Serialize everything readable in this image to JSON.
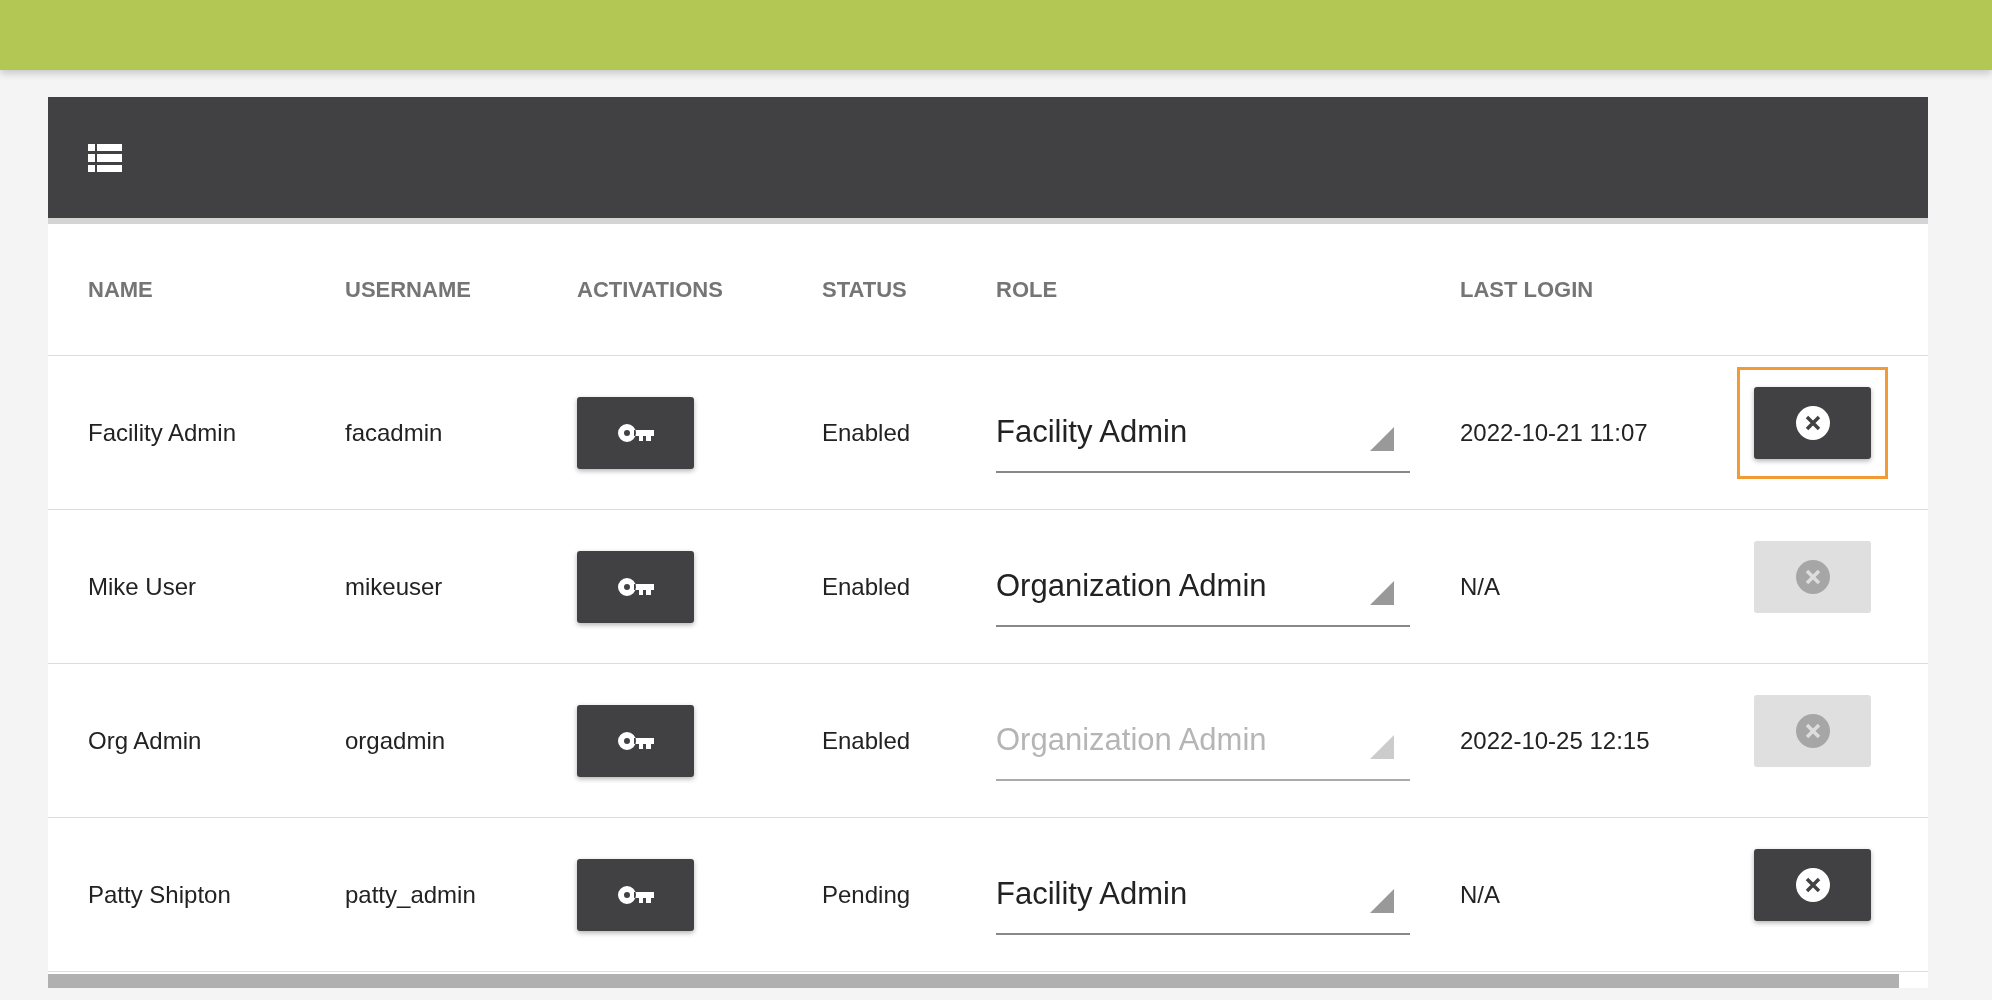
{
  "table": {
    "columns": [
      "NAME",
      "USERNAME",
      "ACTIVATIONS",
      "STATUS",
      "ROLE",
      "LAST LOGIN"
    ],
    "rows": [
      {
        "name": "Facility Admin",
        "username": "facadmin",
        "status": "Enabled",
        "role": {
          "value": "Facility Admin",
          "disabled": false
        },
        "last_login": "2022-10-21 11:07",
        "delete": {
          "disabled": false,
          "focused": true
        }
      },
      {
        "name": "Mike User",
        "username": "mikeuser",
        "status": "Enabled",
        "role": {
          "value": "Organization Admin",
          "disabled": false
        },
        "last_login": "N/A",
        "delete": {
          "disabled": true,
          "focused": false
        }
      },
      {
        "name": "Org Admin",
        "username": "orgadmin",
        "status": "Enabled",
        "role": {
          "value": "Organization Admin",
          "disabled": true
        },
        "last_login": "2022-10-25 12:15",
        "delete": {
          "disabled": true,
          "focused": false
        }
      },
      {
        "name": "Patty Shipton",
        "username": "patty_admin",
        "status": "Pending",
        "role": {
          "value": "Facility Admin",
          "disabled": false
        },
        "last_login": "N/A",
        "delete": {
          "disabled": false,
          "focused": false
        }
      }
    ]
  }
}
